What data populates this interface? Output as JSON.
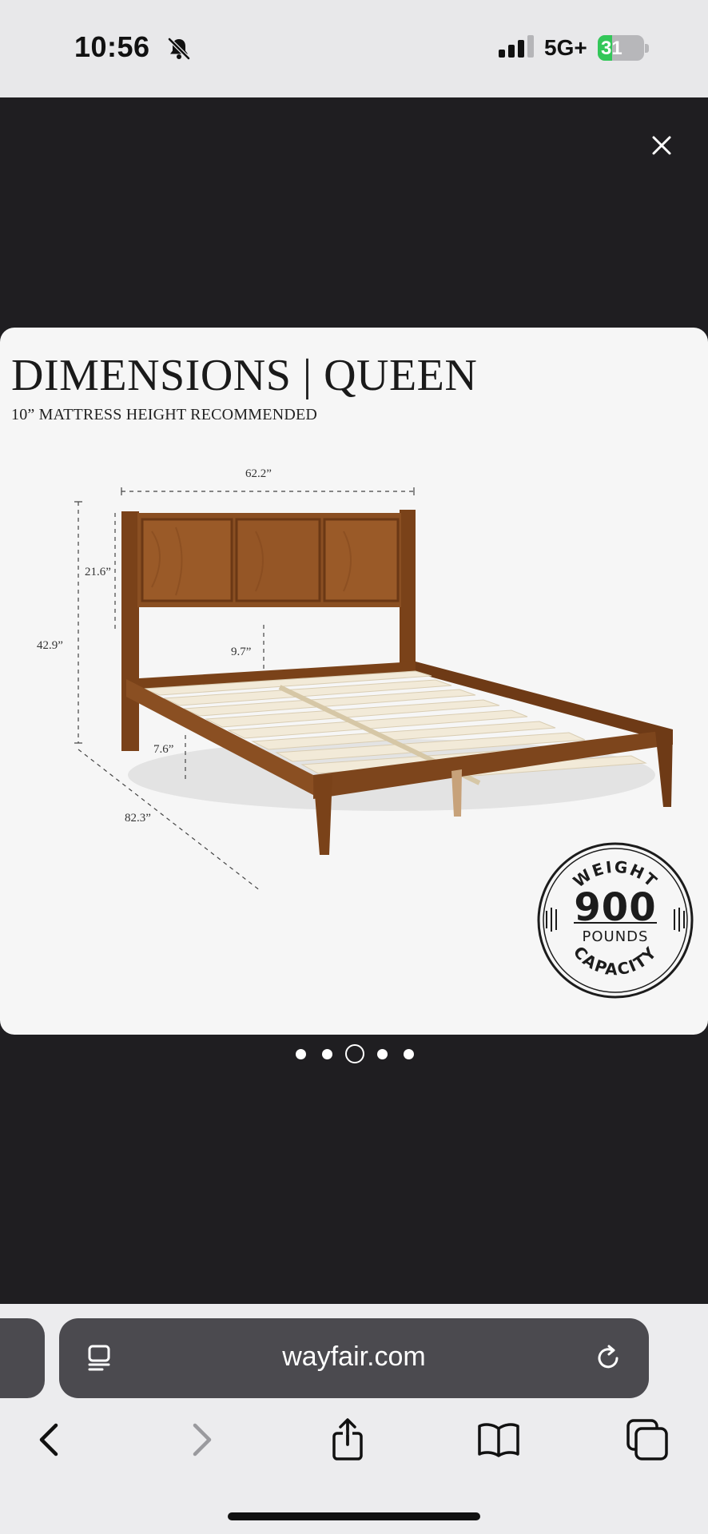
{
  "status_bar": {
    "time": "10:56",
    "network": "5G+",
    "battery_percent": "31",
    "battery_level": 0.31,
    "icons": [
      "bell-slash-icon",
      "cellular-signal-icon",
      "battery-charging-icon"
    ]
  },
  "viewer": {
    "close_icon": "close-icon"
  },
  "product_image": {
    "title": "DIMENSIONS | QUEEN",
    "subtitle": "10” MATTRESS HEIGHT RECOMMENDED",
    "dimensions": {
      "width": "62.2”",
      "headboard_height": "21.6”",
      "total_height": "42.9”",
      "underbed_clearance": "9.7”",
      "rail_height": "7.6”",
      "length": "82.3”"
    },
    "badge": {
      "top": "WEIGHT",
      "number": "900",
      "unit": "POUNDS",
      "bottom": "CAPACITY"
    },
    "colors": {
      "wood": "#8a4f22",
      "wood_dark": "#6b3815",
      "slats": "#f2ead8"
    }
  },
  "pager": {
    "count": 5,
    "active_index": 2
  },
  "browser": {
    "url": "wayfair.com",
    "icons": [
      "reader-mode-icon",
      "reload-icon",
      "back-icon",
      "forward-icon",
      "share-icon",
      "bookmarks-icon",
      "tabs-icon"
    ]
  }
}
